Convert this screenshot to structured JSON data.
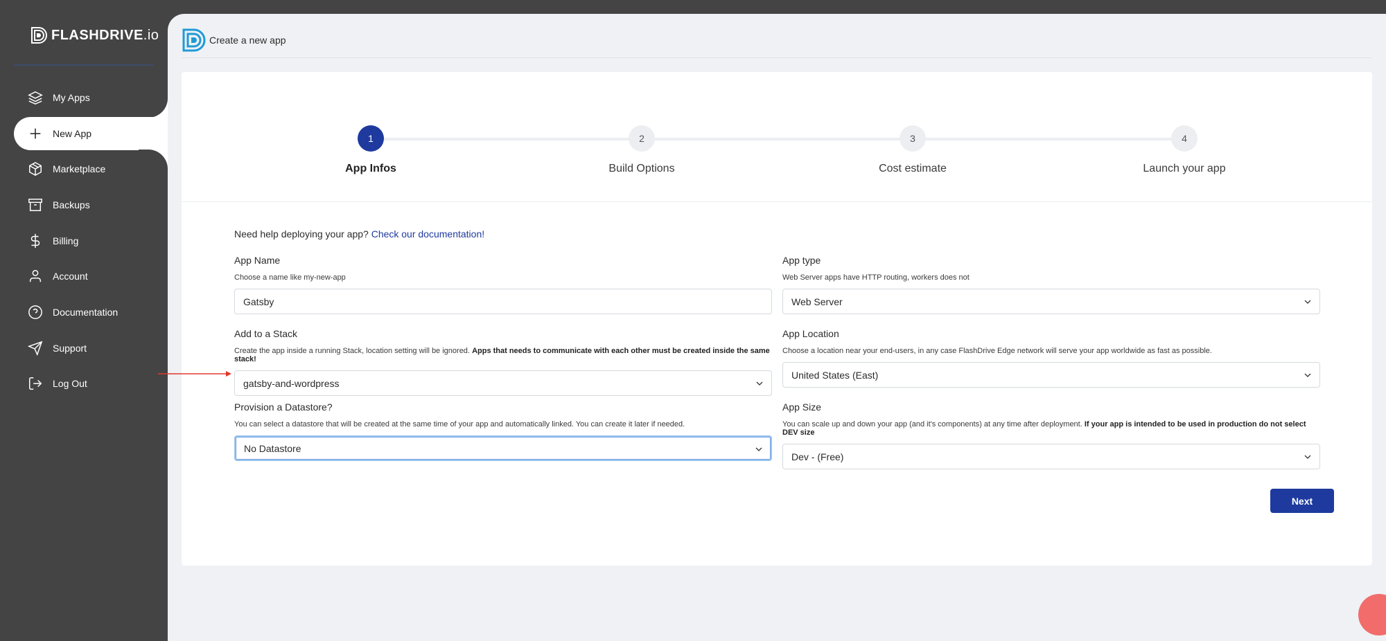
{
  "brand": {
    "name_bold": "FLASHDRIVE",
    "name_light": ".io"
  },
  "sidebar": {
    "items": [
      {
        "label": "My Apps",
        "icon": "layers-icon"
      },
      {
        "label": "New App",
        "icon": "plus-icon",
        "active": true
      },
      {
        "label": "Marketplace",
        "icon": "package-icon"
      },
      {
        "label": "Backups",
        "icon": "archive-icon"
      },
      {
        "label": "Billing",
        "icon": "dollar-icon"
      },
      {
        "label": "Account",
        "icon": "user-icon"
      },
      {
        "label": "Documentation",
        "icon": "help-circle-icon"
      },
      {
        "label": "Support",
        "icon": "send-icon"
      },
      {
        "label": "Log Out",
        "icon": "logout-icon"
      }
    ]
  },
  "header": {
    "title": "Create a new app"
  },
  "stepper": {
    "steps": [
      {
        "number": "1",
        "label": "App Infos",
        "active": true
      },
      {
        "number": "2",
        "label": "Build Options"
      },
      {
        "number": "3",
        "label": "Cost estimate"
      },
      {
        "number": "4",
        "label": "Launch your app"
      }
    ]
  },
  "form": {
    "help_text": "Need help deploying your app?",
    "help_link": "Check our documentation!",
    "app_name": {
      "label": "App Name",
      "hint": "Choose a name like my-new-app",
      "value": "Gatsby"
    },
    "app_type": {
      "label": "App type",
      "hint": "Web Server apps have HTTP routing, workers does not",
      "value": "Web Server"
    },
    "stack": {
      "label": "Add to a Stack",
      "hint": "Create the app inside a running Stack, location setting will be ignored.",
      "hint_bold": "Apps that needs to communicate with each other must be created inside the same stack!",
      "value": "gatsby-and-wordpress"
    },
    "location": {
      "label": "App Location",
      "hint": "Choose a location near your end-users, in any case FlashDrive Edge network will serve your app worldwide as fast as possible.",
      "value": "United States (East)"
    },
    "datastore": {
      "label": "Provision a Datastore?",
      "hint": "You can select a datastore that will be created at the same time of your app and automatically linked. You can create it later if needed.",
      "value": "No Datastore"
    },
    "size": {
      "label": "App Size",
      "hint": "You can scale up and down your app (and it's components) at any time after deployment.",
      "hint_bold": "If your app is intended to be used in production do not select DEV size",
      "value": "Dev - (Free)"
    },
    "next_label": "Next"
  },
  "colors": {
    "primary": "#1e3a9e",
    "sidebar": "#444444",
    "annotation_arrow": "#e0392b"
  }
}
